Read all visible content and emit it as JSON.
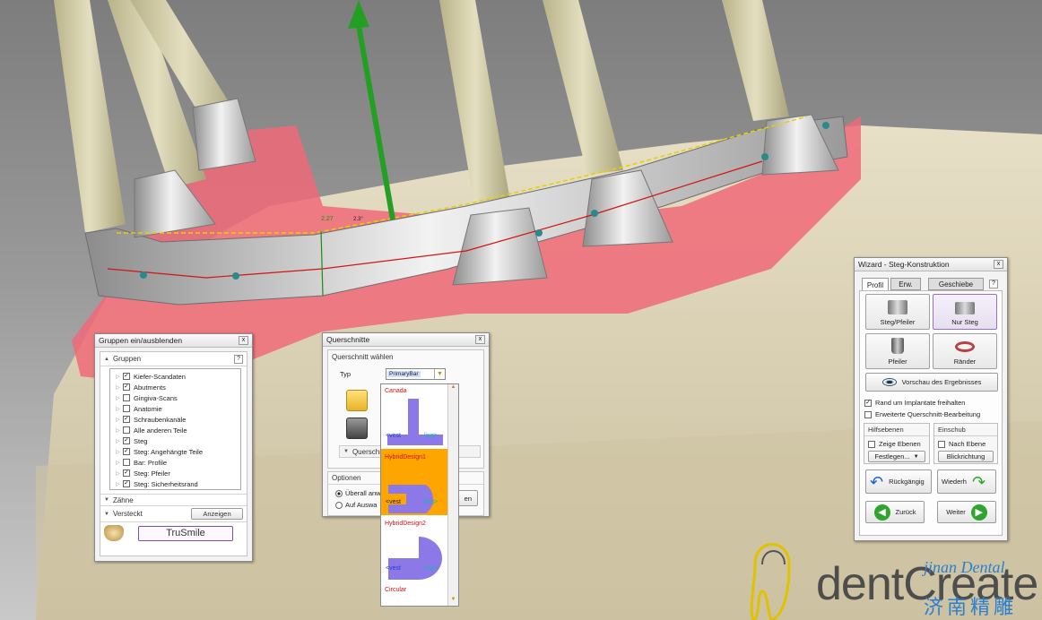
{
  "viewport": {
    "measure_main": "2.27",
    "measure_angle": "2.3°"
  },
  "groups_panel": {
    "title": "Gruppen ein/ausblenden",
    "section_groups": "Gruppen",
    "help": "?",
    "items": [
      {
        "label": "Kiefer-Scandaten",
        "checked": true
      },
      {
        "label": "Abutments",
        "checked": true
      },
      {
        "label": "Gingiva-Scans",
        "checked": false
      },
      {
        "label": "Anatomie",
        "checked": false
      },
      {
        "label": "Schraubenkanäle",
        "checked": true
      },
      {
        "label": "Alle anderen Teile",
        "checked": false
      },
      {
        "label": "Steg",
        "checked": true
      },
      {
        "label": "Steg: Angehängte Teile",
        "checked": true
      },
      {
        "label": "Bar: Profile",
        "checked": false
      },
      {
        "label": "Steg: Pfeiler",
        "checked": true
      },
      {
        "label": "Steg: Sicherheitsrand",
        "checked": true
      }
    ],
    "section_teeth": "Zähne",
    "section_hidden": "Versteckt",
    "show_button": "Anzeigen",
    "library_button": "TruSmile"
  },
  "cross_panel": {
    "title": "Querschnitte",
    "section_select": "Querschnitt wählen",
    "type_label": "Typ",
    "type_value": "PrimaryBar",
    "section_edit": "Querschnitt",
    "section_options": "Optionen",
    "radio_all": "Überall anw",
    "radio_select": "Auf Auswa",
    "apply_fragment": "en",
    "dropdown": [
      {
        "name": "Canada",
        "left": "<vest",
        "right": "ling>",
        "selected": false
      },
      {
        "name": "HybridDesign1",
        "left": "<vest",
        "right": "ling>",
        "selected": true
      },
      {
        "name": "HybridDesign2",
        "left": "<vest",
        "right": "ling>",
        "selected": false
      },
      {
        "name": "Circular",
        "left": "",
        "right": "",
        "selected": false
      }
    ]
  },
  "wizard": {
    "title": "Wizard - Steg-Konstruktion",
    "tabs": [
      "Profil",
      "Erw.",
      "Geschiebe"
    ],
    "help": "?",
    "btn_steg_pfeiler": "Steg/Pfeiler",
    "btn_nur_steg": "Nur Steg",
    "btn_pfeiler": "Pfeiler",
    "btn_raender": "Ränder",
    "preview": "Vorschau des Ergebnisses",
    "check_rand": "Rand um Implantate freihalten",
    "check_erweitert": "Erweiterte Querschnitt-Bearbeitung",
    "hilfsebenen": "Hilfsebenen",
    "zeige_ebenen": "Zeige Ebenen",
    "festlegen": "Festlegen...",
    "einschub": "Einschub",
    "nach_ebene": "Nach Ebene",
    "blickrichtung": "Blickrichtung",
    "undo": "Rückgängig",
    "redo": "Wiederh",
    "back": "Zurück",
    "next": "Weiter"
  },
  "branding": {
    "product": "dentCreate!",
    "watermark_latin": "jinan Dental",
    "watermark_cjk": "济南精雕"
  },
  "colors": {
    "gum": "#f06a78",
    "model": "#ddd3b8",
    "bar": "#cfcfcf",
    "selection_orange": "#ffa500",
    "profile_purple": "#8d78e8",
    "arrow_green": "#23a023",
    "wizard_green": "#2fa52f"
  }
}
